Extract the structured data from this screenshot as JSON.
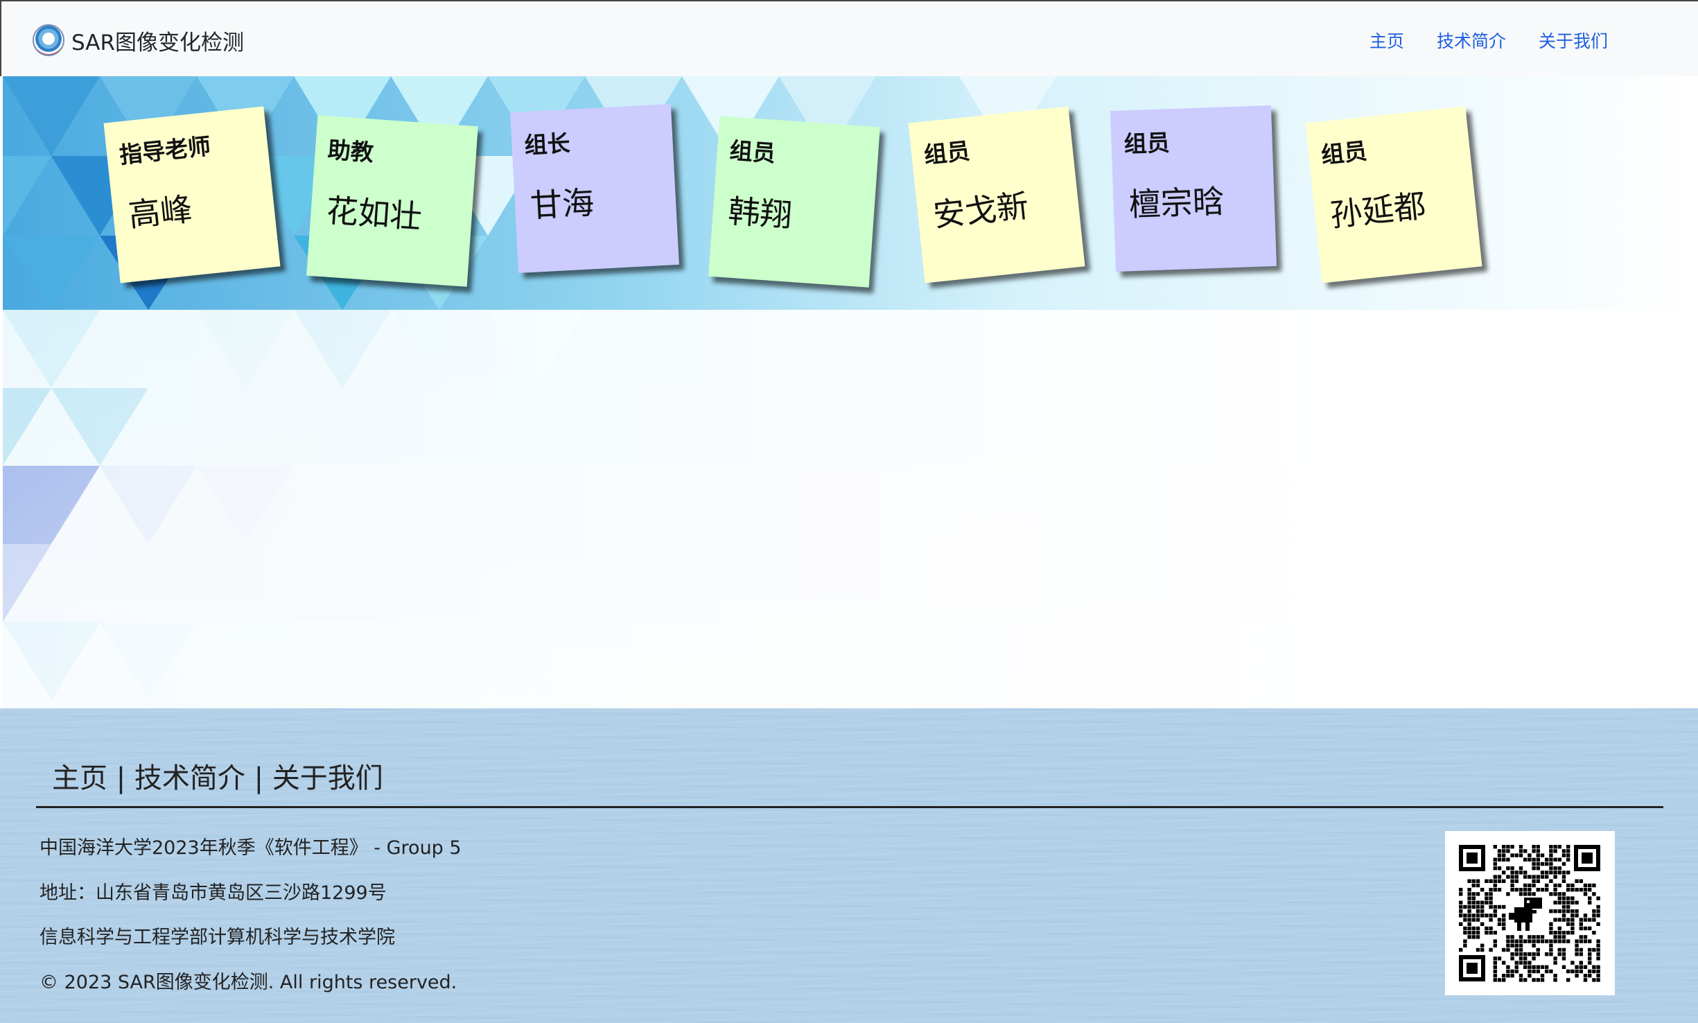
{
  "navbar": {
    "brand": "SAR图像变化检测",
    "links": [
      "主页",
      "技术简介",
      "关于我们"
    ]
  },
  "team": [
    {
      "role": "指导老师",
      "name": "高峰",
      "color": "#ffffcc"
    },
    {
      "role": "助教",
      "name": "花如壮",
      "color": "#ccffcc"
    },
    {
      "role": "组长",
      "name": "甘海",
      "color": "#ccccff"
    },
    {
      "role": "组员",
      "name": "韩翔",
      "color": "#ccffcc"
    },
    {
      "role": "组员",
      "name": "安戈新",
      "color": "#ffffcc"
    },
    {
      "role": "组员",
      "name": "檀宗晗",
      "color": "#ccccff"
    },
    {
      "role": "组员",
      "name": "孙延都",
      "color": "#ffffcc"
    }
  ],
  "footer": {
    "nav": [
      "主页",
      "技术简介",
      "关于我们"
    ],
    "separator": " | ",
    "course": "中国海洋大学2023年秋季《软件工程》 - Group 5",
    "address": "地址：山东省青岛市黄岛区三沙路1299号",
    "college": "信息科学与工程学部计算机科学与技术学院",
    "copyright": "© 2023 SAR图像变化检测. All rights reserved."
  }
}
